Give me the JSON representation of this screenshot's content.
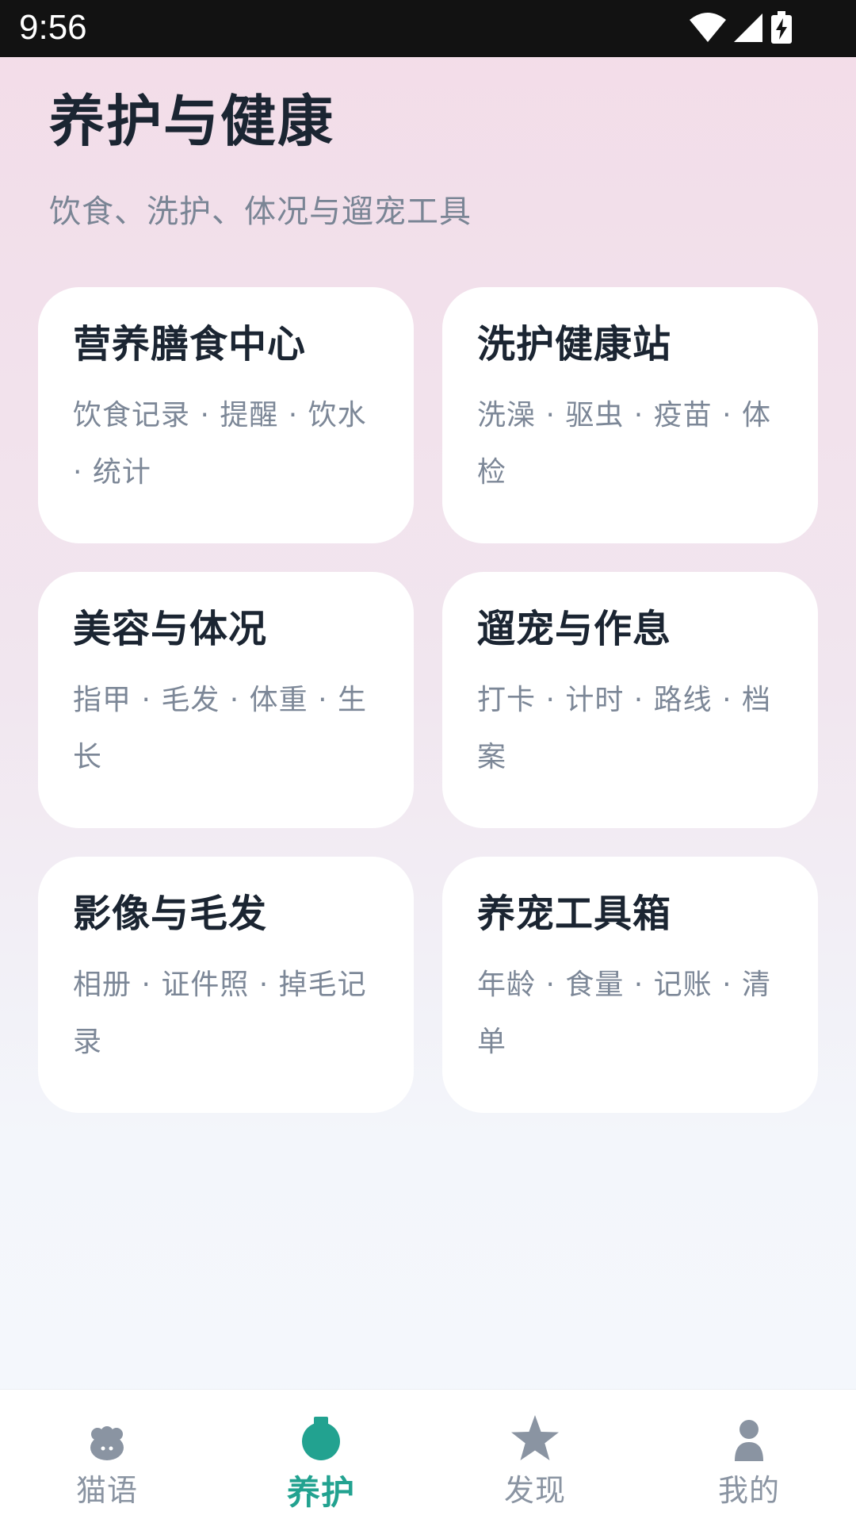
{
  "status_bar": {
    "time": "9:56"
  },
  "header": {
    "title": "养护与健康",
    "subtitle": "饮食、洗护、体况与遛宠工具"
  },
  "cards": [
    {
      "title": "营养膳食中心",
      "desc": "饮食记录 · 提醒 · 饮水 · 统计"
    },
    {
      "title": "洗护健康站",
      "desc": "洗澡 · 驱虫 · 疫苗 · 体检"
    },
    {
      "title": "美容与体况",
      "desc": "指甲 · 毛发 · 体重 · 生长"
    },
    {
      "title": "遛宠与作息",
      "desc": "打卡 · 计时 · 路线 · 档案"
    },
    {
      "title": "影像与毛发",
      "desc": "相册 · 证件照 · 掉毛记录"
    },
    {
      "title": "养宠工具箱",
      "desc": "年龄 · 食量 · 记账 · 清单"
    }
  ],
  "bottom_nav": [
    {
      "label": "猫语",
      "icon": "cat-face-icon",
      "active": false
    },
    {
      "label": "养护",
      "icon": "care-bag-icon",
      "active": true
    },
    {
      "label": "发现",
      "icon": "star-icon",
      "active": false
    },
    {
      "label": "我的",
      "icon": "person-icon",
      "active": false
    }
  ],
  "colors": {
    "accent": "#22a290",
    "inactive_nav": "#8a94a2",
    "title_text": "#1b2532",
    "secondary_text": "#7c8797"
  }
}
